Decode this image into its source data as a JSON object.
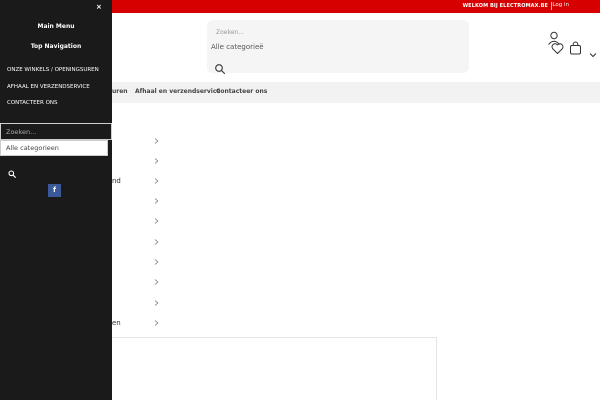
{
  "topbar": {
    "welcome": "WELKOM BIJ ELECTROMAX.BE",
    "login": "Log in"
  },
  "header": {
    "search_placeholder": "Zoeken...",
    "category": "Alle categorieë"
  },
  "nav": {
    "items": [
      "uren",
      "Afhaal en verzendservice",
      "Contacteer ons"
    ]
  },
  "categories": {
    "fragments": [
      "nd",
      "en"
    ]
  },
  "drawer": {
    "close": "×",
    "main_menu": "Main Menu",
    "top_navigation": "Top Navigation",
    "menu_items": [
      "ONZE WINKELS / OPENINGSUREN",
      "AFHAAL EN VERZENDSERVICE",
      "CONTACTEER ONS"
    ],
    "search_placeholder": "Zoeken...",
    "category": "Alle categorieen",
    "facebook": "f"
  },
  "colors": {
    "brand_red": "#d60000",
    "drawer_bg": "#1a1a1a",
    "facebook_blue": "#3b5998"
  }
}
